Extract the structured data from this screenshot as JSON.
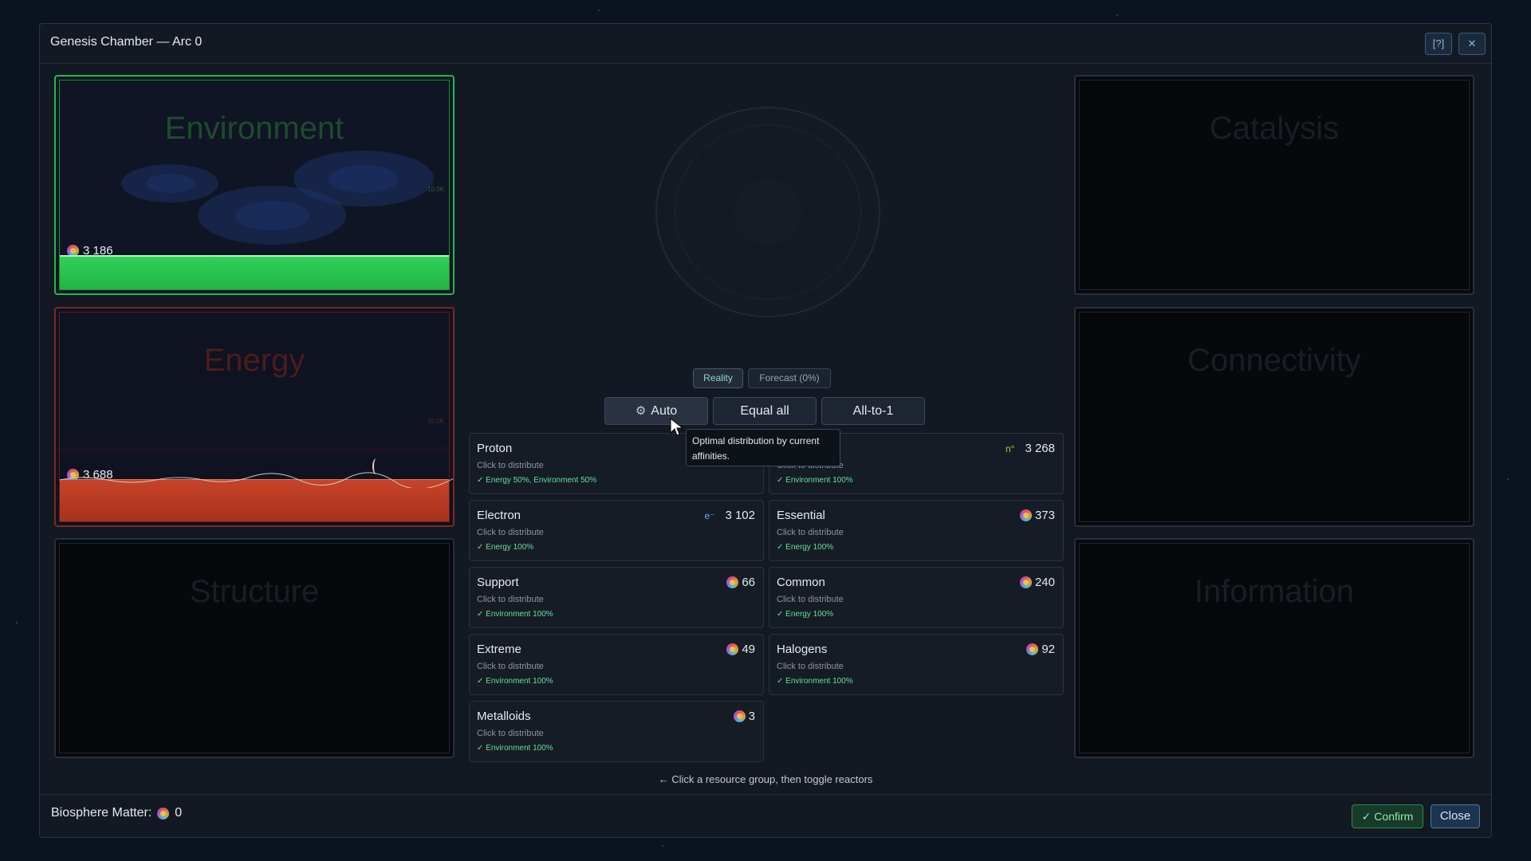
{
  "window": {
    "title": "Genesis Chamber — Arc 0",
    "help_label": "[?]",
    "close_label": "✕"
  },
  "reactors": {
    "environment": {
      "title": "Environment",
      "count": "3 186",
      "tick": "10.0K",
      "level": 0.16
    },
    "energy": {
      "title": "Energy",
      "count": "3 688",
      "tick": "10.0K",
      "level": 0.2
    },
    "structure": {
      "title": "Structure"
    },
    "catalysis": {
      "title": "Catalysis"
    },
    "connectivity": {
      "title": "Connectivity"
    },
    "information": {
      "title": "Information"
    }
  },
  "view_tabs": {
    "reality": "Reality",
    "forecast": "Forecast (0%)"
  },
  "modes": {
    "auto": "Auto",
    "equal": "Equal all",
    "all_to_one": "All-to-1"
  },
  "tooltip": "Optimal distribution by current affinities.",
  "groups": [
    {
      "name": "Proton",
      "sub": "Click to distribute",
      "affinity": "✓ Energy 50%, Environment 50%",
      "symbol": "",
      "value": ""
    },
    {
      "name": "",
      "sub": "Click to distribute",
      "affinity": "✓ Environment 100%",
      "symbol": "n°",
      "value": "3 268"
    },
    {
      "name": "Electron",
      "sub": "Click to distribute",
      "affinity": "✓ Energy 100%",
      "symbol": "e⁻",
      "value": "3 102"
    },
    {
      "name": "Essential",
      "sub": "Click to distribute",
      "affinity": "✓ Energy 100%",
      "symbol": "",
      "value": "373"
    },
    {
      "name": "Support",
      "sub": "Click to distribute",
      "affinity": "✓ Environment 100%",
      "symbol": "",
      "value": "66"
    },
    {
      "name": "Common",
      "sub": "Click to distribute",
      "affinity": "✓ Energy 100%",
      "symbol": "",
      "value": "240"
    },
    {
      "name": "Extreme",
      "sub": "Click to distribute",
      "affinity": "✓ Environment 100%",
      "symbol": "",
      "value": "49"
    },
    {
      "name": "Halogens",
      "sub": "Click to distribute",
      "affinity": "✓ Environment 100%",
      "symbol": "",
      "value": "92"
    },
    {
      "name": "Metalloids",
      "sub": "Click to distribute",
      "affinity": "✓ Environment 100%",
      "symbol": "",
      "value": "3"
    }
  ],
  "hint": "← Click a resource group, then toggle reactors",
  "footer": {
    "biosphere_label": "Biosphere Matter:",
    "biosphere_value": "0",
    "confirm": "✓ Confirm",
    "close": "Close"
  }
}
